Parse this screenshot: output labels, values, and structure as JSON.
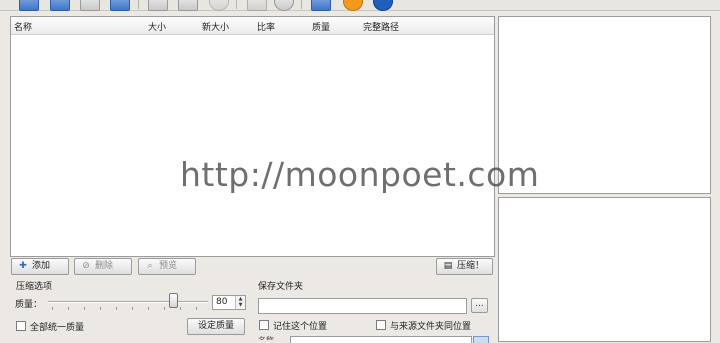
{
  "file_list": {
    "columns": [
      "名称",
      "大小",
      "新大小",
      "比率",
      "质量",
      "完整路径"
    ],
    "rows": []
  },
  "actions": {
    "add_label": "添加",
    "delete_label": "删除",
    "preview_label": "预览",
    "compress_label": "压缩！"
  },
  "compress_options": {
    "title": "压缩选项",
    "quality_label": "质量：",
    "quality_value": 80,
    "quality_value_text": "80",
    "uniform_quality_label": "全部统一质量",
    "set_quality_button": "设定质量"
  },
  "save_folder": {
    "title": "保存文件夹",
    "path_value": "",
    "browse_label": "...",
    "remember_label": "记住这个位置",
    "same_as_source_label": "与来源文件夹同位置",
    "bottom_label": "名称"
  },
  "watermark": "http://moonpoet.com",
  "icons": {
    "add": "plus-icon",
    "delete": "no-entry-icon",
    "preview": "magnifier-icon",
    "compress": "compress-icon"
  },
  "colors": {
    "window_bg": "#ece9e4",
    "toolbar_blue": "#3f76c9",
    "accent_orange": "#f39a1e",
    "info_blue": "#1f5fbf"
  }
}
